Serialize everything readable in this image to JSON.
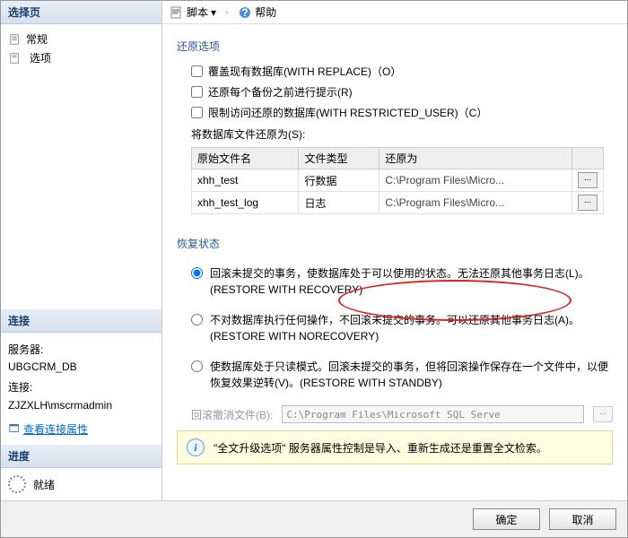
{
  "left": {
    "select_page": "选择页",
    "general": "常规",
    "options": "选项",
    "connection": "连接",
    "server_label": "服务器:",
    "server_value": "UBGCRM_DB",
    "conn_label": "连接:",
    "conn_value": "ZJZXLH\\mscrmadmin",
    "view_conn_props": "查看连接属性",
    "progress": "进度",
    "ready": "就绪"
  },
  "toolbar": {
    "script": "脚本",
    "help": "帮助"
  },
  "restore": {
    "title": "还原选项",
    "opt_replace": "覆盖现有数据库(WITH REPLACE)（O）",
    "opt_prompt": "还原每个备份之前进行提示(R)",
    "opt_restricted": "限制访问还原的数据库(WITH RESTRICTED_USER)（C）",
    "restore_as_label": "将数据库文件还原为(S):",
    "cols": {
      "orig": "原始文件名",
      "type": "文件类型",
      "as": "还原为"
    },
    "rows": [
      {
        "orig": "xhh_test",
        "type": "行数据",
        "as": "C:\\Program Files\\Micro..."
      },
      {
        "orig": "xhh_test_log",
        "type": "日志",
        "as": "C:\\Program Files\\Micro..."
      }
    ]
  },
  "recovery": {
    "title": "恢复状态",
    "opt1": "回滚未提交的事务，使数据库处于可以使用的状态。无法还原其他事务日志(L)。(RESTORE WITH RECOVERY)",
    "opt2": "不对数据库执行任何操作，不回滚未提交的事务。可以还原其他事务日志(A)。(RESTORE WITH NORECOVERY)",
    "opt3": "使数据库处于只读模式。回滚未提交的事务，但将回滚操作保存在一个文件中，以便恢复效果逆转(V)。(RESTORE WITH STANDBY)",
    "undo_label": "回滚撤消文件(B):",
    "undo_value": "C:\\Program Files\\Microsoft SQL Serve"
  },
  "info": {
    "text": "\"全文升级选项\" 服务器属性控制是导入、重新生成还是重置全文检索。"
  },
  "footer": {
    "ok": "确定",
    "cancel": "取消"
  }
}
